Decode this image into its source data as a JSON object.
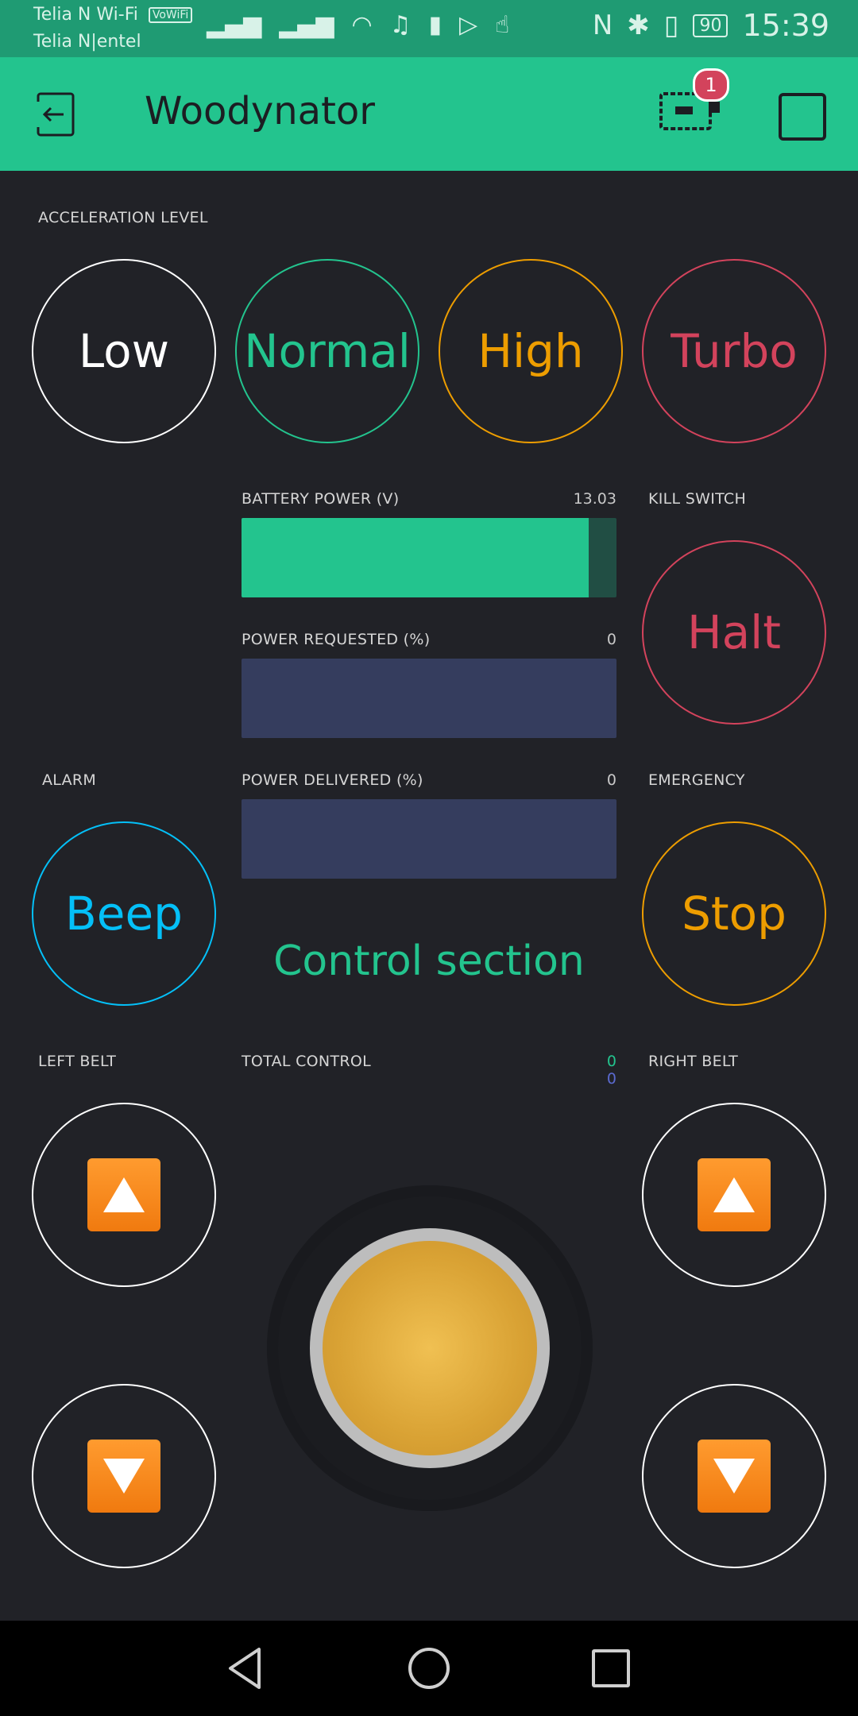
{
  "status_bar": {
    "carrier1": "Telia N Wi-Fi",
    "vowifi": "VoWiFi",
    "carrier2": "Telia N|entel",
    "battery": "90",
    "time": "15:39"
  },
  "app_bar": {
    "title": "Woodynator",
    "device_badge": "1"
  },
  "acceleration": {
    "label": "ACCELERATION LEVEL",
    "buttons": [
      "Low",
      "Normal",
      "High",
      "Turbo"
    ]
  },
  "battery_power": {
    "label": "BATTERY POWER (V)",
    "value": "13.03",
    "fill_percent": 92.5
  },
  "power_requested": {
    "label": "POWER REQUESTED (%)",
    "value": "0",
    "fill_percent": 0
  },
  "power_delivered": {
    "label": "POWER DELIVERED (%)",
    "value": "0",
    "fill_percent": 0
  },
  "kill_switch": {
    "label": "KILL SWITCH",
    "button": "Halt"
  },
  "alarm": {
    "label": "ALARM",
    "button": "Beep"
  },
  "emergency": {
    "label": "EMERGENCY",
    "button": "Stop"
  },
  "section_title": "Control section",
  "left_belt": {
    "label": "LEFT BELT"
  },
  "right_belt": {
    "label": "RIGHT BELT"
  },
  "total_control": {
    "label": "TOTAL CONTROL",
    "x_value": "0",
    "y_value": "0"
  },
  "colors": {
    "accent": "#23c48e",
    "orange": "#ed9d00",
    "red": "#d3435c",
    "blue": "#04c0f8",
    "background": "#212227"
  }
}
